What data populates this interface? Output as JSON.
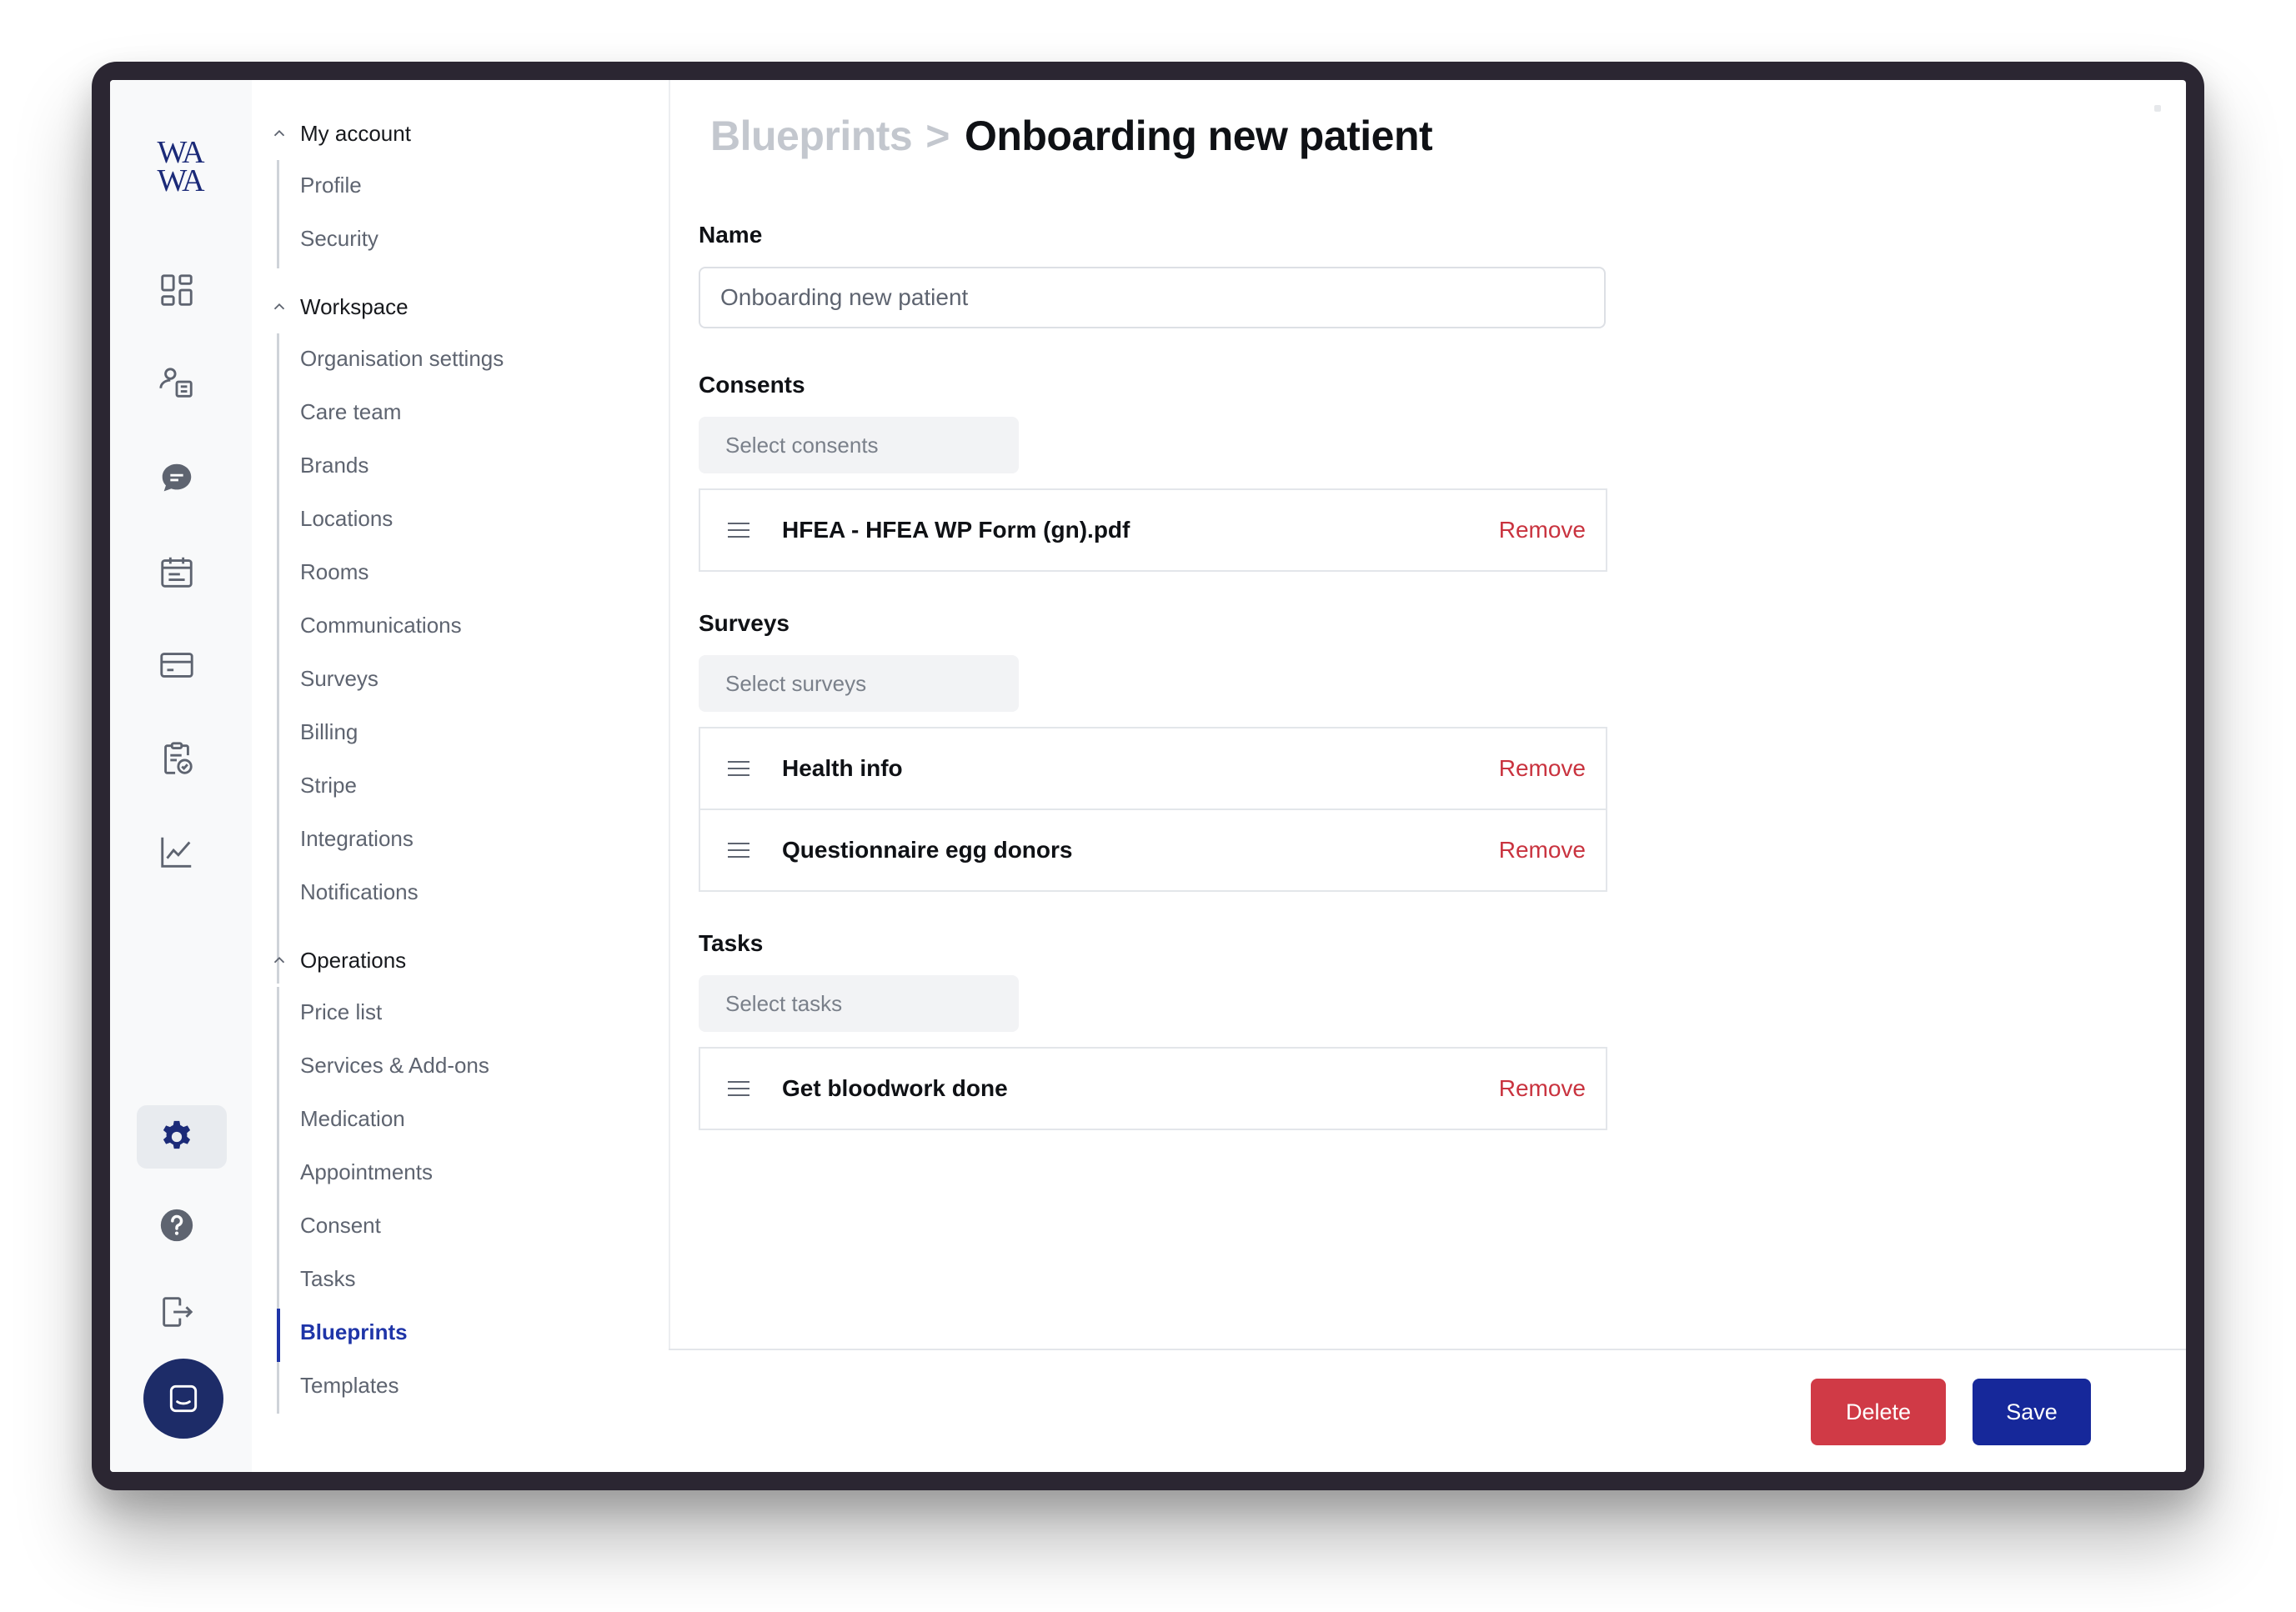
{
  "brand": {
    "logo_line1": "WA",
    "logo_line2": "WA",
    "accent": "#1f35a8",
    "danger": "#d03a46",
    "primary": "#16289a"
  },
  "rail": {
    "icons": [
      "dashboard-icon",
      "patients-icon",
      "chat-icon",
      "calendar-icon",
      "card-icon",
      "clipboard-check-icon",
      "chart-icon",
      "gear-icon",
      "help-icon",
      "logout-icon",
      "chat-support-icon"
    ],
    "active": "gear-icon"
  },
  "subnav": {
    "sections": [
      {
        "title": "My account",
        "items": [
          "Profile",
          "Security"
        ]
      },
      {
        "title": "Workspace",
        "items": [
          "Organisation settings",
          "Care team",
          "Brands",
          "Locations",
          "Rooms",
          "Communications",
          "Surveys",
          "Billing",
          "Stripe",
          "Integrations",
          "Notifications"
        ]
      },
      {
        "title": "Operations",
        "items": [
          "Price list",
          "Services & Add-ons",
          "Medication",
          "Appointments",
          "Consent",
          "Tasks",
          "Blueprints",
          "Templates"
        ]
      }
    ],
    "active_item": "Blueprints"
  },
  "header": {
    "parent": "Blueprints",
    "separator": ">",
    "current": "Onboarding new patient"
  },
  "form": {
    "name": {
      "label": "Name",
      "value": "Onboarding new patient"
    },
    "consents": {
      "label": "Consents",
      "select_label": "Select consents",
      "items": [
        "HFEA - HFEA WP Form (gn).pdf"
      ]
    },
    "surveys": {
      "label": "Surveys",
      "select_label": "Select surveys",
      "items": [
        "Health info",
        "Questionnaire egg donors"
      ]
    },
    "tasks": {
      "label": "Tasks",
      "select_label": "Select tasks",
      "items": [
        "Get bloodwork done"
      ]
    },
    "remove_label": "Remove"
  },
  "footer": {
    "delete_label": "Delete",
    "save_label": "Save"
  }
}
